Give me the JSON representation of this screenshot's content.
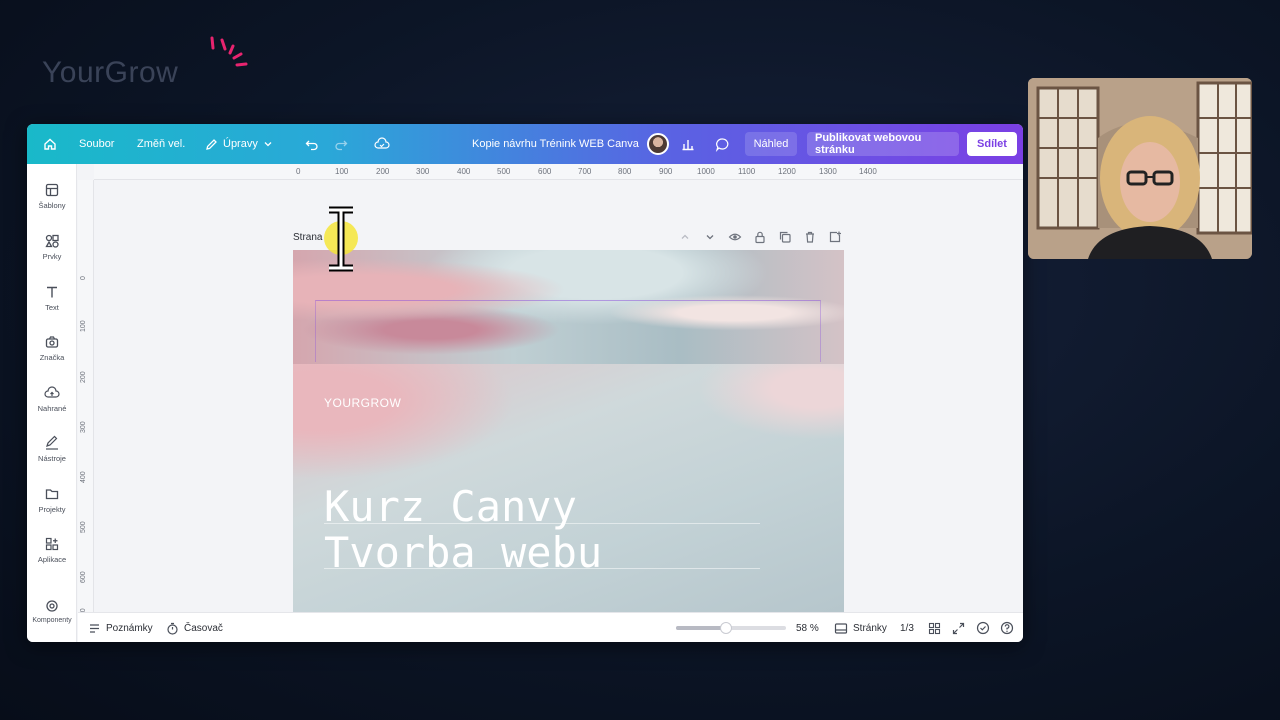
{
  "brand": {
    "name": "YourGrow"
  },
  "topbar": {
    "home_icon": "home-icon",
    "file_label": "Soubor",
    "resize_label": "Změň vel.",
    "edit_label": "Úpravy",
    "doc_title": "Kopie návrhu Trénink WEB Canva",
    "preview_label": "Náhled",
    "publish_label": "Publikovat webovou stránku",
    "share_label": "Sdílet"
  },
  "sidebar": {
    "items": [
      {
        "label": "Šablony",
        "icon": "templates-icon"
      },
      {
        "label": "Prvky",
        "icon": "elements-icon"
      },
      {
        "label": "Text",
        "icon": "text-icon"
      },
      {
        "label": "Značka",
        "icon": "brand-icon"
      },
      {
        "label": "Nahrané",
        "icon": "upload-icon"
      },
      {
        "label": "Nástroje",
        "icon": "draw-icon"
      },
      {
        "label": "Projekty",
        "icon": "folder-icon"
      },
      {
        "label": "Aplikace",
        "icon": "apps-icon"
      },
      {
        "label": "Komponenty",
        "icon": "components-icon"
      }
    ]
  },
  "ruler": {
    "top": [
      "0",
      "100",
      "200",
      "300",
      "400",
      "500",
      "600",
      "700",
      "800",
      "900",
      "1000",
      "1100",
      "1200",
      "1300",
      "1400"
    ],
    "left": [
      "0",
      "100",
      "200",
      "300",
      "400",
      "500",
      "600",
      "700",
      "800"
    ]
  },
  "canvas": {
    "page_label": "Strana",
    "design": {
      "logo_text": "YOURGROW",
      "title_line1": "Kurz Canvy",
      "title_line2": "Tvorba webu"
    }
  },
  "bottombar": {
    "notes_label": "Poznámky",
    "timer_label": "Časovač",
    "zoom_value": "58 %",
    "zoom_fraction": 0.45,
    "pages_label": "Stránky",
    "page_counter": "1/3"
  },
  "colors": {
    "topbar_start": "#19b9c9",
    "topbar_end": "#7b3fe4",
    "share_text": "#7b3fe4",
    "brand_accent": "#e8246f"
  }
}
